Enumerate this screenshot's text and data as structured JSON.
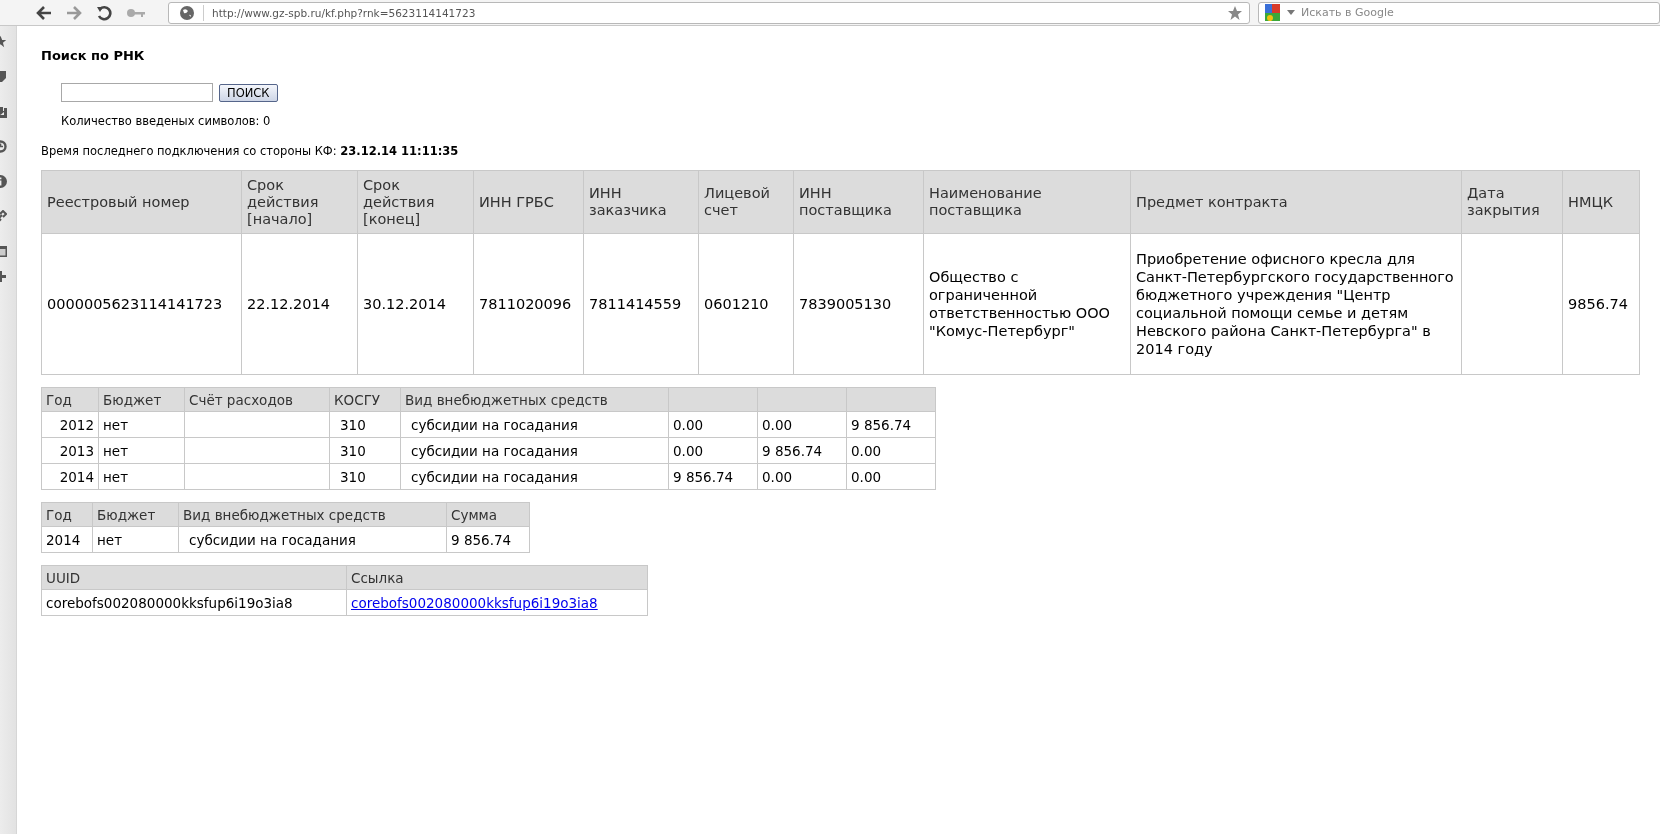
{
  "browser": {
    "url": "http://www.gz-spb.ru/kf.php?rnk=5623114141723",
    "search_placeholder": "Искать в Google"
  },
  "page": {
    "title": "Поиск по РНК",
    "search_button": "ПОИСК",
    "char_count": "Количество введеных символов: 0",
    "last_connection": "Время последнего подключения со стороны КФ: **23.12.14 11:11:35**"
  },
  "contract_table": {
    "columns": [
      "Реестровый номер",
      "Срок действия [начало]",
      "Срок действия [конец]",
      "ИНН ГРБС",
      "ИНН заказчика",
      "Лицевой счет",
      "ИНН поставщика",
      "Наименование поставщика",
      "Предмет контракта",
      "Дата закрытия",
      "НМЦК"
    ],
    "rows": [
      [
        "0000005623114141723",
        "22.12.2014",
        "30.12.2014",
        "7811020096",
        "7811414559",
        "0601210",
        "7839005130",
        "Общество с ограниченной ответственностью ООО \"Комус-Петербург\"",
        "Приобретение офисного кресла для Санкт-Петербургского государственного бюджетного учреждения \"Центр социальной помощи семье и детям Невского района Санкт-Петербурга\" в 2014 году",
        "",
        "9856.74"
      ]
    ]
  },
  "finance_table": {
    "columns": [
      "Год",
      "Бюджет",
      "Счёт расходов",
      "КОСГУ",
      "Вид внебюджетных средств",
      "",
      "",
      ""
    ],
    "rows": [
      [
        "2012",
        "нет",
        "",
        "310",
        "субсидии на госадания",
        "0.00",
        "0.00",
        "9 856.74"
      ],
      [
        "2013",
        "нет",
        "",
        "310",
        "субсидии на госадания",
        "0.00",
        "9 856.74",
        "0.00"
      ],
      [
        "2014",
        "нет",
        "",
        "310",
        "субсидии на госадания",
        "9 856.74",
        "0.00",
        "0.00"
      ]
    ]
  },
  "sum_table": {
    "columns": [
      "Год",
      "Бюджет",
      "Вид внебюджетных средств",
      "Сумма"
    ],
    "rows": [
      [
        "2014",
        "нет",
        "субсидии на госадания",
        "9 856.74"
      ]
    ]
  },
  "uuid_table": {
    "columns": [
      "UUID",
      "Ссылка"
    ],
    "rows": [
      {
        "uuid": "corebofs002080000kksfup6i19o3ia8",
        "link": "corebofs002080000kksfup6i19o3ia8"
      }
    ]
  }
}
